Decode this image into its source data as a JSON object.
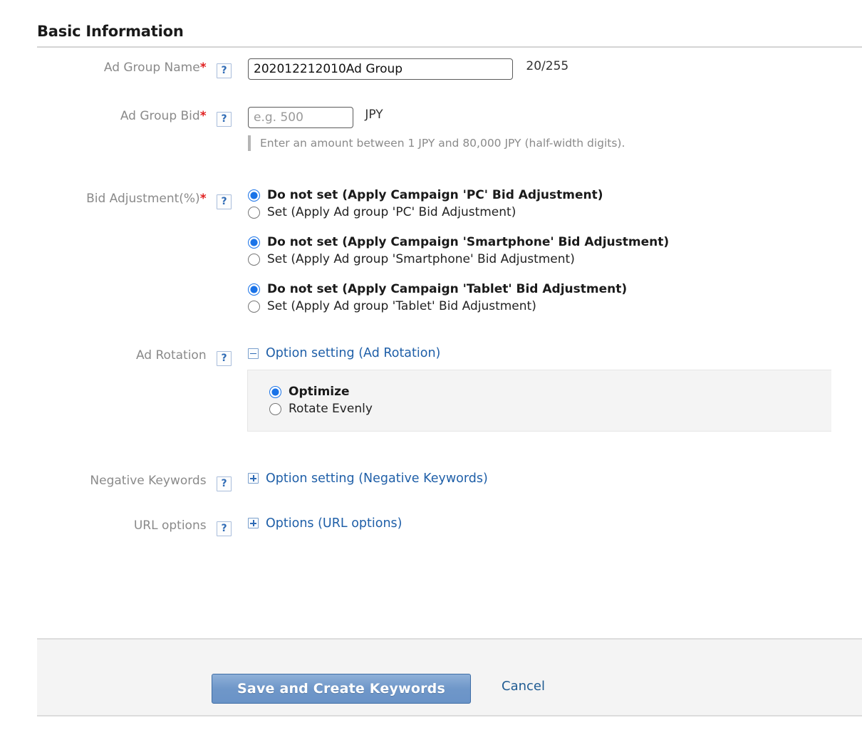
{
  "section": {
    "title": "Basic Information"
  },
  "fields": {
    "ad_group_name": {
      "label": "Ad Group Name",
      "required_mark": "*",
      "help": "?",
      "value": "202012212010Ad Group",
      "placeholder": "",
      "counter": "20/255"
    },
    "ad_group_bid": {
      "label": "Ad Group Bid",
      "required_mark": "*",
      "help": "?",
      "value": "",
      "placeholder": "e.g. 500",
      "unit": "JPY",
      "hint": "Enter an amount between 1 JPY and 80,000 JPY (half-width digits)."
    },
    "bid_adjustment": {
      "label": "Bid Adjustment(%)",
      "required_mark": "*",
      "help": "?",
      "groups": [
        {
          "name": "pc",
          "options": [
            {
              "label": "Do not set (Apply Campaign 'PC' Bid Adjustment)",
              "selected": true
            },
            {
              "label": "Set (Apply Ad group 'PC' Bid Adjustment)",
              "selected": false
            }
          ]
        },
        {
          "name": "smartphone",
          "options": [
            {
              "label": "Do not set (Apply Campaign 'Smartphone' Bid Adjustment)",
              "selected": true
            },
            {
              "label": "Set (Apply Ad group 'Smartphone' Bid Adjustment)",
              "selected": false
            }
          ]
        },
        {
          "name": "tablet",
          "options": [
            {
              "label": "Do not set (Apply Campaign 'Tablet' Bid Adjustment)",
              "selected": true
            },
            {
              "label": "Set (Apply Ad group 'Tablet' Bid Adjustment)",
              "selected": false
            }
          ]
        }
      ]
    },
    "ad_rotation": {
      "label": "Ad Rotation",
      "help": "?",
      "toggle_label": "Option setting (Ad Rotation)",
      "toggle_state": "expanded",
      "options": [
        {
          "label": "Optimize",
          "selected": true
        },
        {
          "label": "Rotate Evenly",
          "selected": false
        }
      ]
    },
    "negative_keywords": {
      "label": "Negative Keywords",
      "help": "?",
      "toggle_label": "Option setting (Negative Keywords)",
      "toggle_state": "collapsed"
    },
    "url_options": {
      "label": "URL options",
      "help": "?",
      "toggle_label": "Options (URL options)",
      "toggle_state": "collapsed"
    }
  },
  "footer": {
    "save_label": "Save and Create Keywords",
    "cancel_label": "Cancel"
  },
  "colors": {
    "accent_blue": "#1a73e8",
    "link_blue": "#1f5fa8",
    "required_red": "#e02020",
    "button_blue": "#6f97c9",
    "panel_gray": "#f4f4f4"
  }
}
